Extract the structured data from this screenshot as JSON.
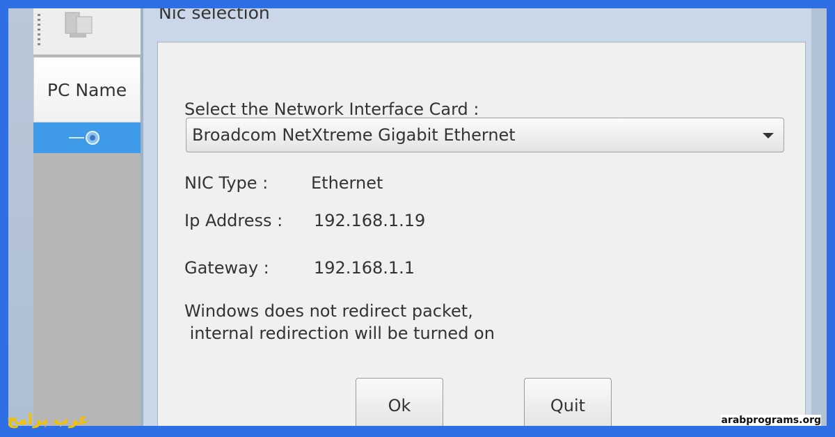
{
  "left_panel": {
    "column_header": "PC Name",
    "pc_icon": "pc-tower-icon",
    "selected_row_icon": "network-adapter-icon"
  },
  "dialog": {
    "title": "Nic selection",
    "select_label": "Select the Network Interface Card :",
    "nic_dropdown": {
      "selected": "Broadcom NetXtreme Gigabit Ethernet",
      "icon": "chevron-down-icon"
    },
    "nic_type": {
      "label": "NIC Type :",
      "value": "Ethernet"
    },
    "ip_address": {
      "label": "Ip Address :",
      "value": "192.168.1.19"
    },
    "gateway": {
      "label": "Gateway :",
      "value": "192.168.1.1"
    },
    "message_line1": "Windows does not redirect packet,",
    "message_line2": " internal redirection will be turned on",
    "ok_label": "Ok",
    "quit_label": "Quit"
  },
  "branding": {
    "arabic": "عرب برامج",
    "url": "arabprograms.org"
  },
  "colors": {
    "border_blue": "#2f6fe6",
    "selection_blue": "#3f9bea",
    "brand_yellow": "#f2c200"
  }
}
